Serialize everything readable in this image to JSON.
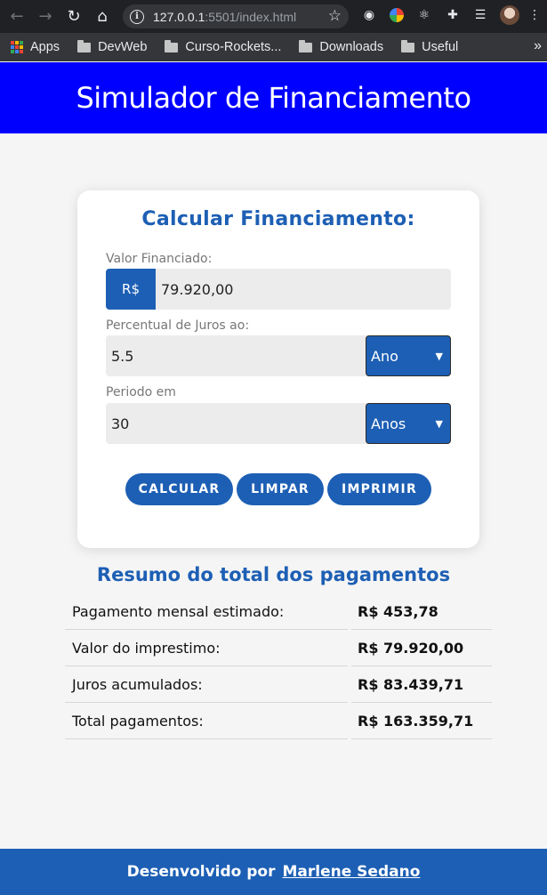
{
  "browser": {
    "url_host": "127.0.0.1",
    "url_rest": ":5501/index.html",
    "bookmarks": [
      "Apps",
      "DevWeb",
      "Curso-Rockets...",
      "Downloads",
      "Useful"
    ],
    "more": "»"
  },
  "header": {
    "title": "Simulador de Financiamento"
  },
  "form": {
    "title": "Calcular Financiamento:",
    "valor_label": "Valor Financiado:",
    "currency_prefix": "R$",
    "valor_value": "79.920,00",
    "juros_label": "Percentual de Juros ao:",
    "juros_value": "5.5",
    "juros_unit": "Ano",
    "periodo_label": "Periodo em",
    "periodo_value": "30",
    "periodo_unit": "Anos",
    "buttons": {
      "calcular": "CALCULAR",
      "limpar": "LIMPAR",
      "imprimir": "IMPRIMIR"
    }
  },
  "summary": {
    "title": "Resumo do total dos pagamentos",
    "rows": [
      {
        "label": "Pagamento mensal estimado:",
        "value": "R$ 453,78"
      },
      {
        "label": "Valor do imprestimo:",
        "value": "R$ 79.920,00"
      },
      {
        "label": "Juros acumulados:",
        "value": "R$ 83.439,71"
      },
      {
        "label": "Total pagamentos:",
        "value": "R$ 163.359,71"
      }
    ]
  },
  "footer": {
    "text": "Desenvolvido por",
    "author": "Marlene Sedano"
  }
}
